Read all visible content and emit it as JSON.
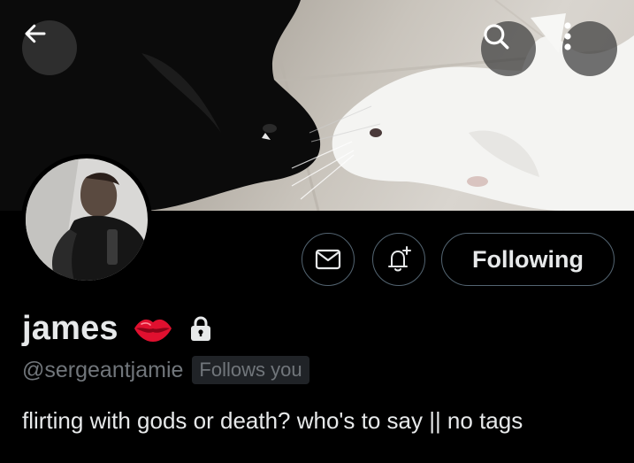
{
  "banner": {
    "back_icon": "arrow-left-icon",
    "search_icon": "search-icon",
    "more_icon": "more-vertical-icon"
  },
  "profile": {
    "display_name": "james",
    "name_emoji_icon": "kiss-lips-icon",
    "protected_icon": "lock-icon",
    "handle": "@sergeantjamie",
    "follows_badge": "Follows you",
    "bio": "flirting with gods or death? who's to say || no tags"
  },
  "actions": {
    "message_icon": "envelope-icon",
    "notify_icon": "bell-plus-icon",
    "follow_label": "Following"
  },
  "colors": {
    "background": "#000000",
    "text_primary": "#e7e9ea",
    "text_secondary": "#71767b",
    "border": "#536471",
    "badge_bg": "#202327",
    "lips": "#e0102f"
  }
}
